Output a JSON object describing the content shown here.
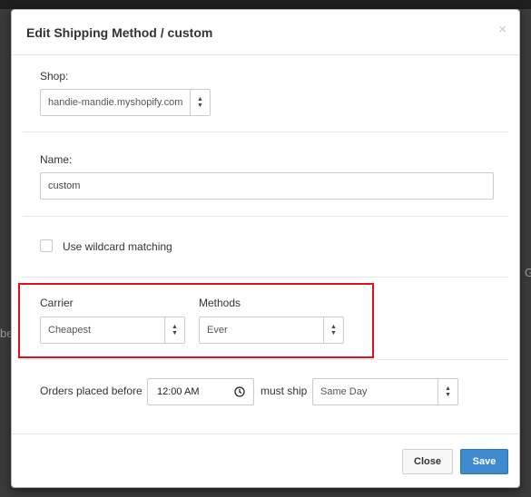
{
  "background": {
    "left_fragment": "be",
    "right_fragment": "G"
  },
  "modal": {
    "title": "Edit Shipping Method / custom",
    "close_symbol": "×"
  },
  "shop": {
    "label": "Shop:",
    "value": "handie-mandie.myshopify.com"
  },
  "name": {
    "label": "Name:",
    "value": "custom"
  },
  "wildcard": {
    "label": "Use wildcard matching",
    "checked": false
  },
  "carrier": {
    "label": "Carrier",
    "value": "Cheapest"
  },
  "methods": {
    "label": "Methods",
    "value": "Ever"
  },
  "orders": {
    "label_before": "Orders placed before",
    "time_value": "12:00 AM",
    "label_must_ship": "must ship",
    "ship_value": "Same Day"
  },
  "footer": {
    "close_label": "Close",
    "save_label": "Save"
  },
  "colors": {
    "highlight": "#e0101e",
    "primary_button": "#3d8bce"
  }
}
